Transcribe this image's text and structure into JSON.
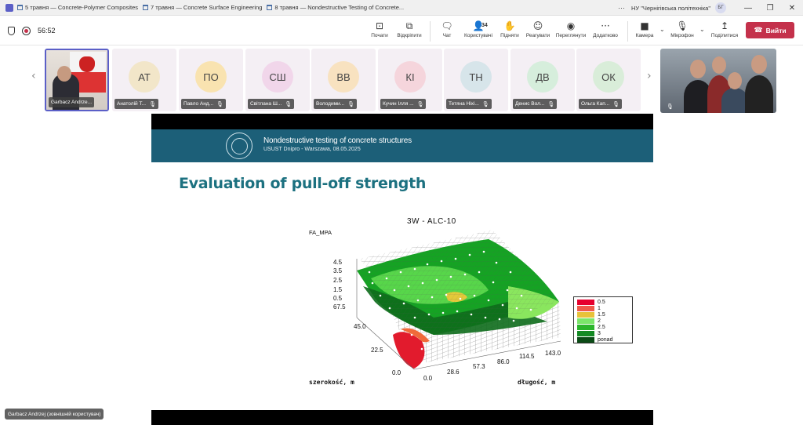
{
  "titlebar": {
    "tabs": [
      "5 травня — Concrete-Polymer Composites",
      "7 травня — Concrete Surface Engineering",
      "8 травня — Nondestructive Testing of Concrete..."
    ],
    "org": "НУ \"Чернігівська політехніка\"",
    "user_initials": "БГ",
    "minimize": "—",
    "restore": "❐",
    "close": "✕"
  },
  "toolbar": {
    "timer": "56:52",
    "items": [
      {
        "label": "Почати",
        "icon": "⊡"
      },
      {
        "label": "Відкріпити",
        "icon": "⧉"
      },
      {
        "label": "Чат",
        "icon": "🗨"
      },
      {
        "label": "Користувачі",
        "icon": "👤",
        "count": "34"
      },
      {
        "label": "Підняти",
        "icon": "✋"
      },
      {
        "label": "Реагувати",
        "icon": "☺"
      },
      {
        "label": "Переглянути",
        "icon": "◉"
      },
      {
        "label": "Додатково",
        "icon": "···"
      },
      {
        "label": "Камера",
        "icon": "■"
      },
      {
        "label": "Мікрофон",
        "icon": "🎙"
      },
      {
        "label": "Поділитися",
        "icon": "↥"
      }
    ],
    "leave_label": "Вийти",
    "leave_icon": "☎"
  },
  "participants": [
    {
      "name": "Garbacz Andrze...",
      "initials": "",
      "video": true
    },
    {
      "name": "Анатолій Т...",
      "initials": "АТ",
      "color": "#f2e6c9"
    },
    {
      "name": "Павло Анд...",
      "initials": "ПО",
      "color": "#f9e3b0"
    },
    {
      "name": "Світлана Ш...",
      "initials": "СШ",
      "color": "#f1d6ea"
    },
    {
      "name": "Володими...",
      "initials": "ВВ",
      "color": "#f8e2c0"
    },
    {
      "name": "Кучин Ілля ...",
      "initials": "КІ",
      "color": "#f5d5dc"
    },
    {
      "name": "Тетяна Ніхі...",
      "initials": "ТН",
      "color": "#d7e5ea"
    },
    {
      "name": "Денис Вол...",
      "initials": "ДВ",
      "color": "#d6eedc"
    },
    {
      "name": "Ольга Кап...",
      "initials": "ОК",
      "color": "#d9edd9"
    }
  ],
  "slide": {
    "header_line1": "Nondestructive testing of concrete structures",
    "header_line2": "USUST Dnipro - Warszawa, 08.05.2025",
    "title": "Evaluation of pull-off strength"
  },
  "chart_data": {
    "type": "surface3d",
    "title": "3W - ALC-10",
    "zlabel": "FA_MPA",
    "xlabel": "szerokość, m",
    "ylabel": "długość, m",
    "z_ticks": [
      "4.5",
      "3.5",
      "2.5",
      "1.5",
      "0.5"
    ],
    "x_ticks": [
      "67.5",
      "45.0",
      "22.5",
      "0.0"
    ],
    "y_ticks": [
      "0.0",
      "28.6",
      "57.3",
      "86.0",
      "114.5",
      "143.0"
    ],
    "legend": [
      {
        "label": "0.5",
        "color": "#e6002e"
      },
      {
        "label": "1",
        "color": "#ef5a4a"
      },
      {
        "label": "1.5",
        "color": "#e8c23a"
      },
      {
        "label": "2",
        "color": "#7be66a"
      },
      {
        "label": "2.5",
        "color": "#2bb52b"
      },
      {
        "label": "3",
        "color": "#138a23"
      },
      {
        "label": "ponad",
        "color": "#0b4b16"
      }
    ]
  },
  "presenter_label": "Garbacz Andrzej (зовнішній користувач)"
}
